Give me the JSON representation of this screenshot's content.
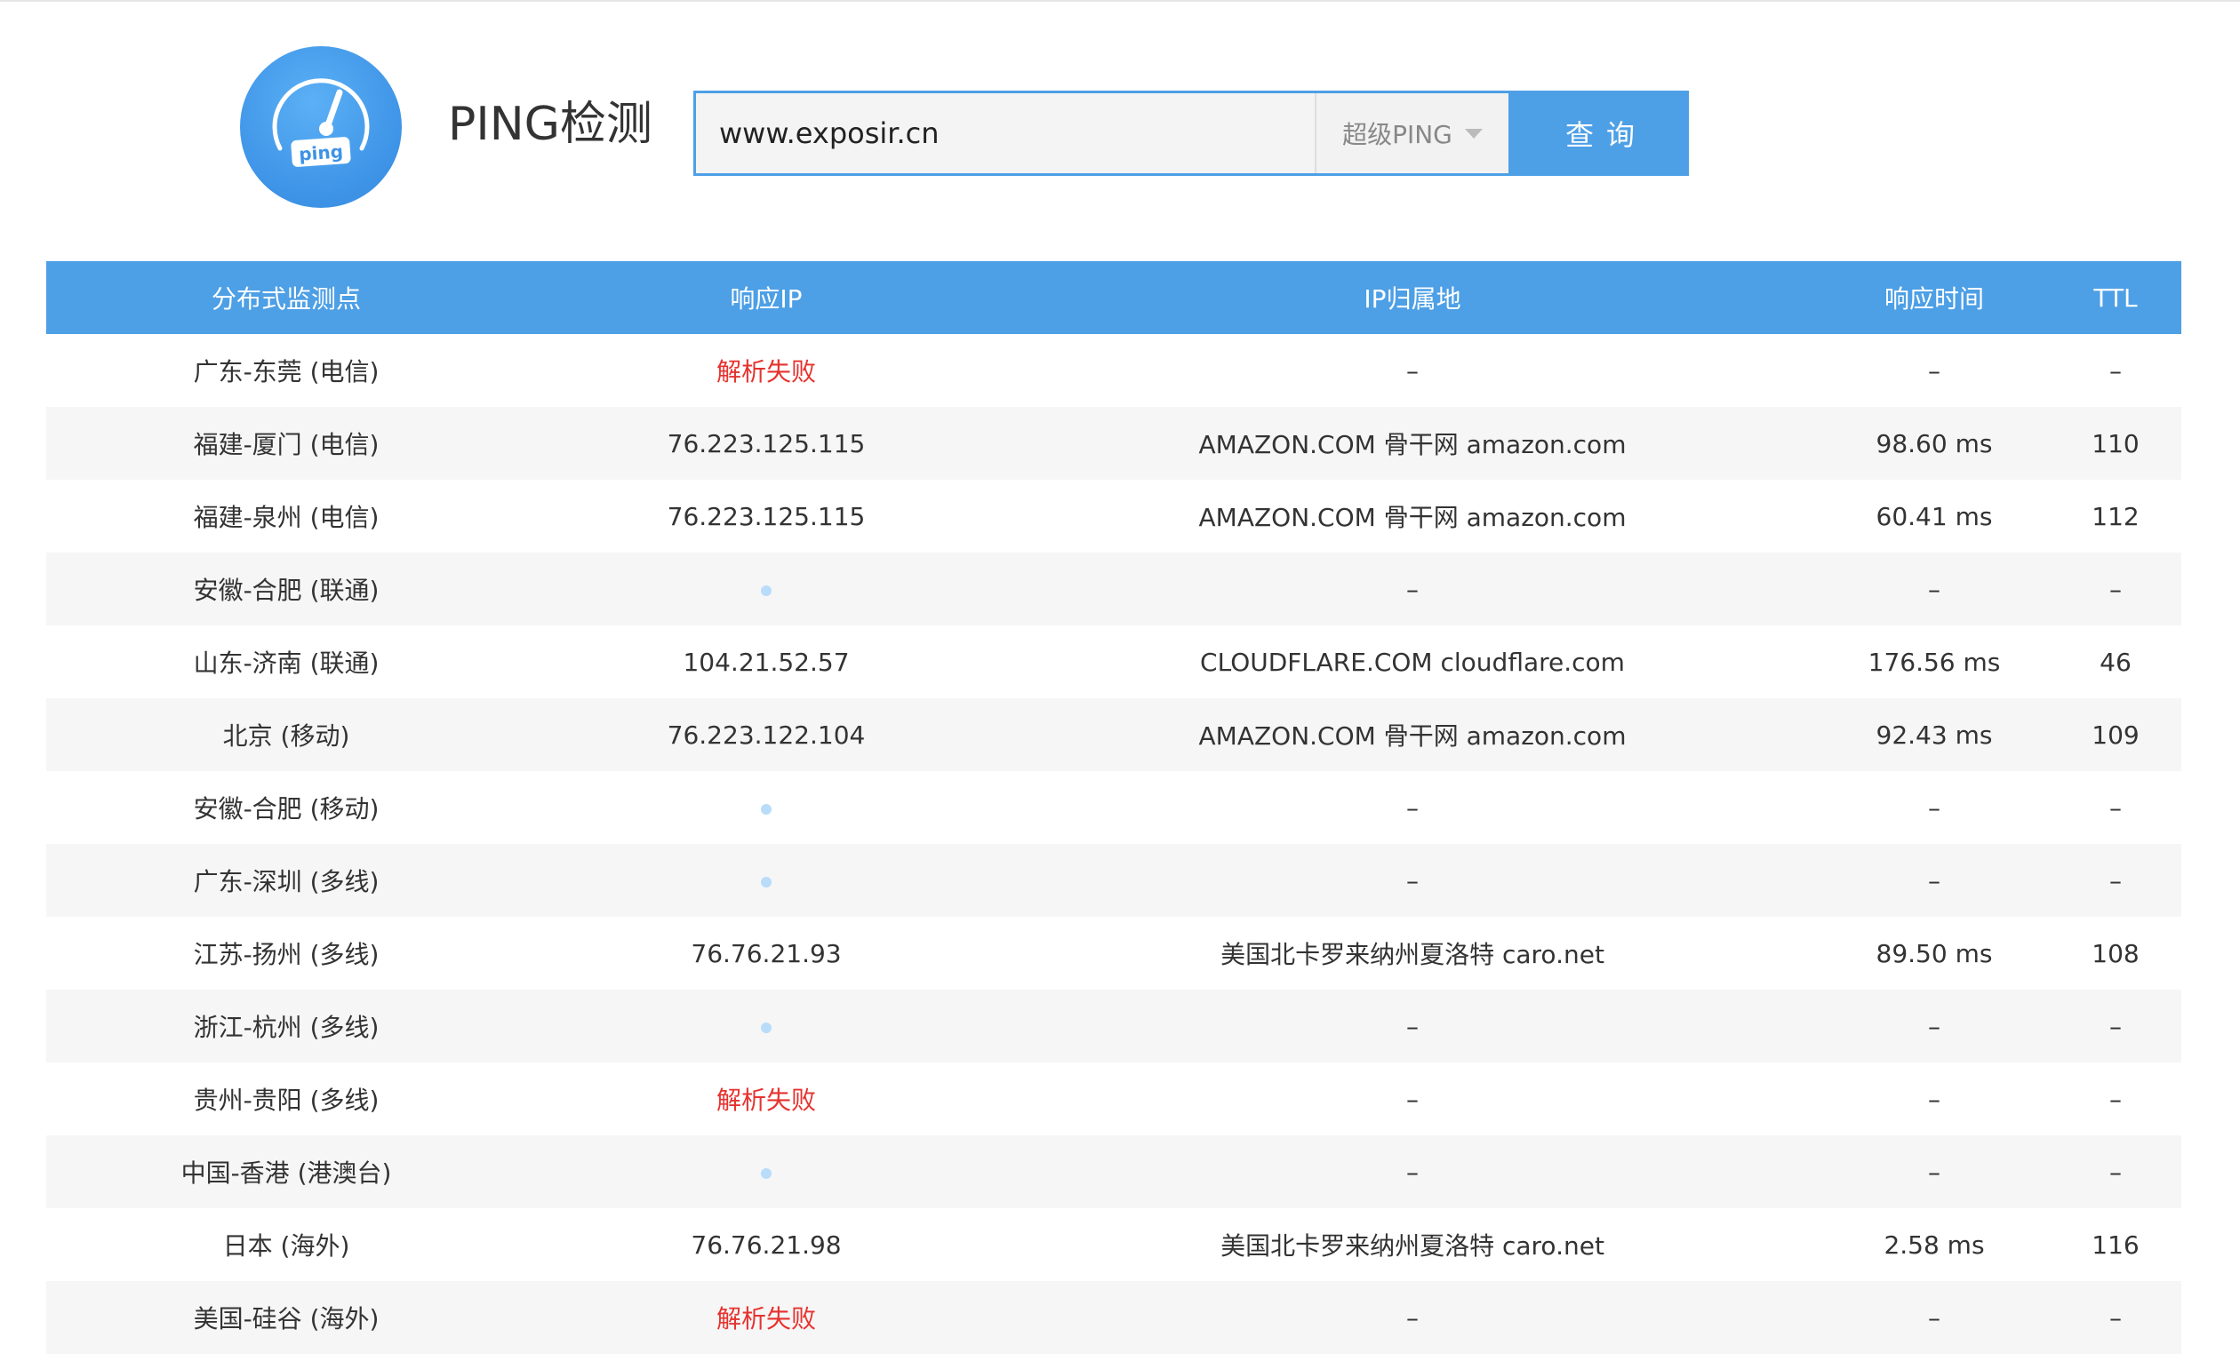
{
  "header": {
    "title": "PING检测",
    "logo_text": "ping",
    "search_value": "www.exposir.cn",
    "mode_label": "超级PING",
    "query_label": "查询",
    "accent_color": "#4d9fe6"
  },
  "table": {
    "columns": [
      "分布式监测点",
      "响应IP",
      "IP归属地",
      "响应时间",
      "TTL"
    ],
    "rows": [
      {
        "node": "广东-东莞 (电信)",
        "ip": "解析失败",
        "status": "fail",
        "location": "–",
        "time": "–",
        "ttl": "–"
      },
      {
        "node": "福建-厦门 (电信)",
        "ip": "76.223.125.115",
        "status": "ok",
        "location": "AMAZON.COM 骨干网 amazon.com",
        "time": "98.60 ms",
        "ttl": "110"
      },
      {
        "node": "福建-泉州 (电信)",
        "ip": "76.223.125.115",
        "status": "ok",
        "location": "AMAZON.COM 骨干网 amazon.com",
        "time": "60.41 ms",
        "ttl": "112"
      },
      {
        "node": "安徽-合肥 (联通)",
        "ip": "",
        "status": "pending",
        "location": "–",
        "time": "–",
        "ttl": "–"
      },
      {
        "node": "山东-济南 (联通)",
        "ip": "104.21.52.57",
        "status": "ok",
        "location": "CLOUDFLARE.COM cloudflare.com",
        "time": "176.56 ms",
        "ttl": "46"
      },
      {
        "node": "北京 (移动)",
        "ip": "76.223.122.104",
        "status": "ok",
        "location": "AMAZON.COM 骨干网 amazon.com",
        "time": "92.43 ms",
        "ttl": "109"
      },
      {
        "node": "安徽-合肥 (移动)",
        "ip": "",
        "status": "pending",
        "location": "–",
        "time": "–",
        "ttl": "–"
      },
      {
        "node": "广东-深圳 (多线)",
        "ip": "",
        "status": "pending",
        "location": "–",
        "time": "–",
        "ttl": "–"
      },
      {
        "node": "江苏-扬州 (多线)",
        "ip": "76.76.21.93",
        "status": "ok",
        "location": "美国北卡罗来纳州夏洛特 caro.net",
        "time": "89.50 ms",
        "ttl": "108"
      },
      {
        "node": "浙江-杭州 (多线)",
        "ip": "",
        "status": "pending",
        "location": "–",
        "time": "–",
        "ttl": "–"
      },
      {
        "node": "贵州-贵阳 (多线)",
        "ip": "解析失败",
        "status": "fail",
        "location": "–",
        "time": "–",
        "ttl": "–"
      },
      {
        "node": "中国-香港 (港澳台)",
        "ip": "",
        "status": "pending",
        "location": "–",
        "time": "–",
        "ttl": "–"
      },
      {
        "node": "日本 (海外)",
        "ip": "76.76.21.98",
        "status": "ok",
        "location": "美国北卡罗来纳州夏洛特 caro.net",
        "time": "2.58 ms",
        "ttl": "116"
      },
      {
        "node": "美国-硅谷 (海外)",
        "ip": "解析失败",
        "status": "fail",
        "location": "–",
        "time": "–",
        "ttl": "–"
      }
    ]
  }
}
